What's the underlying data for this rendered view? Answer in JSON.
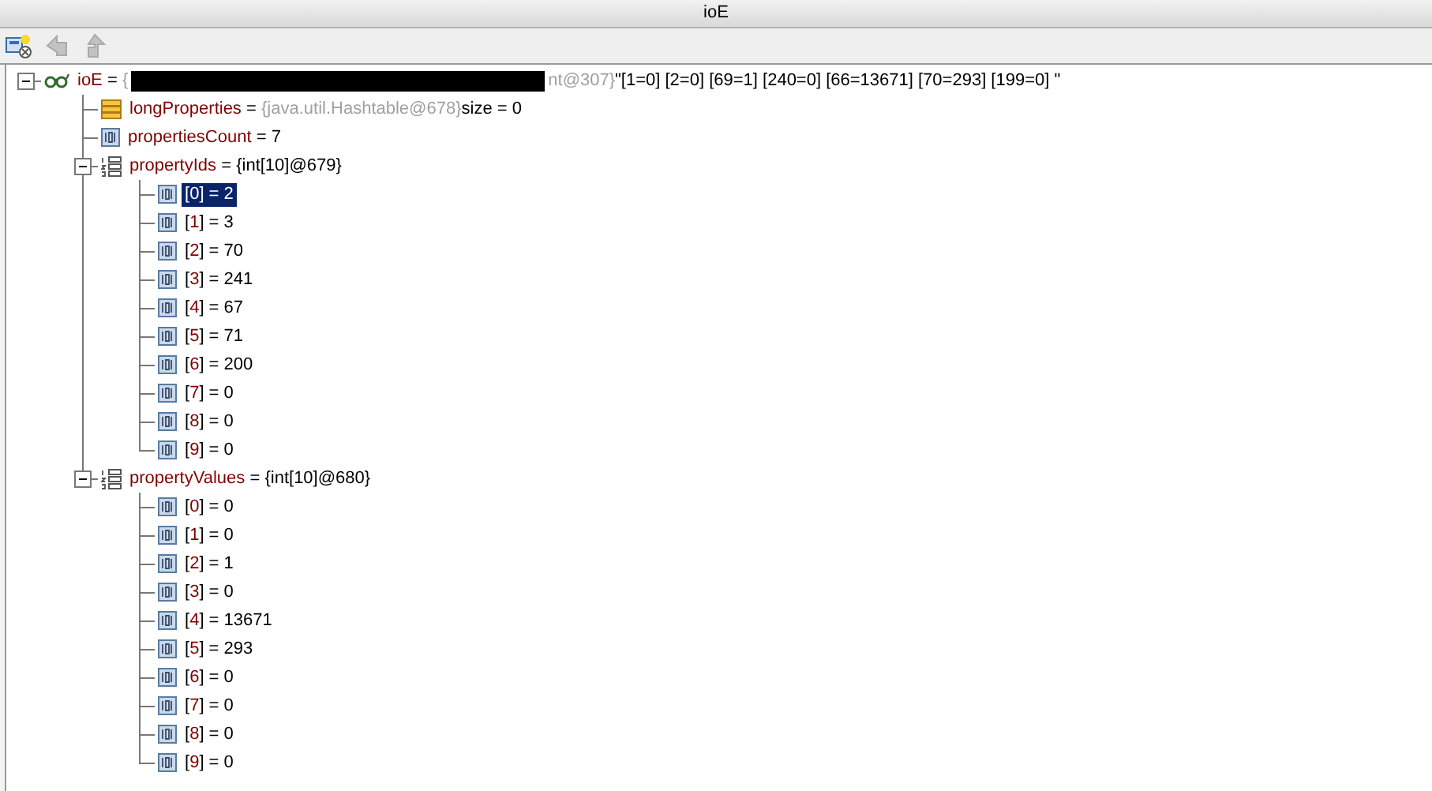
{
  "window": {
    "title": "ioE"
  },
  "toolbar": [
    {
      "kind": "tree",
      "disabled": false
    },
    {
      "kind": "back",
      "disabled": true
    },
    {
      "kind": "up",
      "disabled": true
    }
  ],
  "tree": {
    "kind": "watch",
    "name": "ioE",
    "operator": "=",
    "type": "{",
    "redacted": true,
    "type_tail": "nt@307}",
    "value": "\"[1=0] [2=0] [69=1] [240=0] [66=13671] [70=293] [199=0] \"",
    "expanded": true,
    "children": [
      {
        "kind": "hashtable",
        "name": "longProperties",
        "operator": "=",
        "type": "{java.util.Hashtable@678}",
        "value": "size = 0"
      },
      {
        "kind": "primitive",
        "name": "propertiesCount",
        "operator": "=",
        "value": "7"
      },
      {
        "kind": "array",
        "name": "propertyIds",
        "operator": "=",
        "value": "{int[10]@679}",
        "expanded": true,
        "children": [
          {
            "kind": "element",
            "open": "[",
            "index": "0",
            "close": "]",
            "operator": "=",
            "value": "2",
            "selected": true
          },
          {
            "kind": "element",
            "open": "[",
            "index": "1",
            "close": "]",
            "operator": "=",
            "value": "3",
            "selected": false
          },
          {
            "kind": "element",
            "open": "[",
            "index": "2",
            "close": "]",
            "operator": "=",
            "value": "70",
            "selected": false
          },
          {
            "kind": "element",
            "open": "[",
            "index": "3",
            "close": "]",
            "operator": "=",
            "value": "241",
            "selected": false
          },
          {
            "kind": "element",
            "open": "[",
            "index": "4",
            "close": "]",
            "operator": "=",
            "value": "67",
            "selected": false
          },
          {
            "kind": "element",
            "open": "[",
            "index": "5",
            "close": "]",
            "operator": "=",
            "value": "71",
            "selected": false
          },
          {
            "kind": "element",
            "open": "[",
            "index": "6",
            "close": "]",
            "operator": "=",
            "value": "200",
            "selected": false
          },
          {
            "kind": "element",
            "open": "[",
            "index": "7",
            "close": "]",
            "operator": "=",
            "value": "0",
            "selected": false
          },
          {
            "kind": "element",
            "open": "[",
            "index": "8",
            "close": "]",
            "operator": "=",
            "value": "0",
            "selected": false
          },
          {
            "kind": "element",
            "open": "[",
            "index": "9",
            "close": "]",
            "operator": "=",
            "value": "0",
            "selected": false
          }
        ]
      },
      {
        "kind": "array",
        "name": "propertyValues",
        "operator": "=",
        "value": "{int[10]@680}",
        "expanded": true,
        "children": [
          {
            "kind": "element",
            "open": "[",
            "index": "0",
            "close": "]",
            "operator": "=",
            "value": "0",
            "selected": false
          },
          {
            "kind": "element",
            "open": "[",
            "index": "1",
            "close": "]",
            "operator": "=",
            "value": "0",
            "selected": false
          },
          {
            "kind": "element",
            "open": "[",
            "index": "2",
            "close": "]",
            "operator": "=",
            "value": "1",
            "selected": false
          },
          {
            "kind": "element",
            "open": "[",
            "index": "3",
            "close": "]",
            "operator": "=",
            "value": "0",
            "selected": false
          },
          {
            "kind": "element",
            "open": "[",
            "index": "4",
            "close": "]",
            "operator": "=",
            "value": "13671",
            "selected": false
          },
          {
            "kind": "element",
            "open": "[",
            "index": "5",
            "close": "]",
            "operator": "=",
            "value": "293",
            "selected": false
          },
          {
            "kind": "element",
            "open": "[",
            "index": "6",
            "close": "]",
            "operator": "=",
            "value": "0",
            "selected": false
          },
          {
            "kind": "element",
            "open": "[",
            "index": "7",
            "close": "]",
            "operator": "=",
            "value": "0",
            "selected": false
          },
          {
            "kind": "element",
            "open": "[",
            "index": "8",
            "close": "]",
            "operator": "=",
            "value": "0",
            "selected": false
          },
          {
            "kind": "element",
            "open": "[",
            "index": "9",
            "close": "]",
            "operator": "=",
            "value": "0",
            "selected": false
          }
        ]
      }
    ]
  }
}
